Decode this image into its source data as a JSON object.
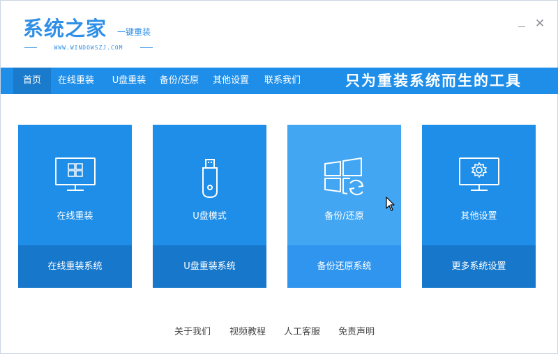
{
  "header": {
    "logo_title": "系统之家",
    "logo_subtitle": "一键重装",
    "logo_url": "WWW.WINDOWSZJ.COM",
    "minimize_icon": "minimize-icon",
    "close_icon": "close-icon",
    "close_glyph": "✕"
  },
  "nav": {
    "items": [
      {
        "label": "首页",
        "active": true
      },
      {
        "label": "在线重装"
      },
      {
        "label": "U盘重装"
      },
      {
        "label": "备份/还原"
      },
      {
        "label": "其他设置"
      },
      {
        "label": "联系我们"
      }
    ],
    "slogan": "只为重装系统而生的工具"
  },
  "cards": [
    {
      "title": "在线重装",
      "action": "在线重装系统",
      "icon": "monitor-windows-icon"
    },
    {
      "title": "U盘模式",
      "action": "U盘重装系统",
      "icon": "usb-drive-icon"
    },
    {
      "title": "备份/还原",
      "action": "备份还原系统",
      "icon": "windows-restore-icon",
      "hovered": true
    },
    {
      "title": "其他设置",
      "action": "更多系统设置",
      "icon": "monitor-gear-icon"
    }
  ],
  "footer": {
    "links": [
      "关于我们",
      "视频教程",
      "人工客服",
      "免责声明"
    ]
  },
  "colors": {
    "primary": "#1e8ee9",
    "primary_dark": "#1677cb",
    "hover": "#42a6f3"
  }
}
